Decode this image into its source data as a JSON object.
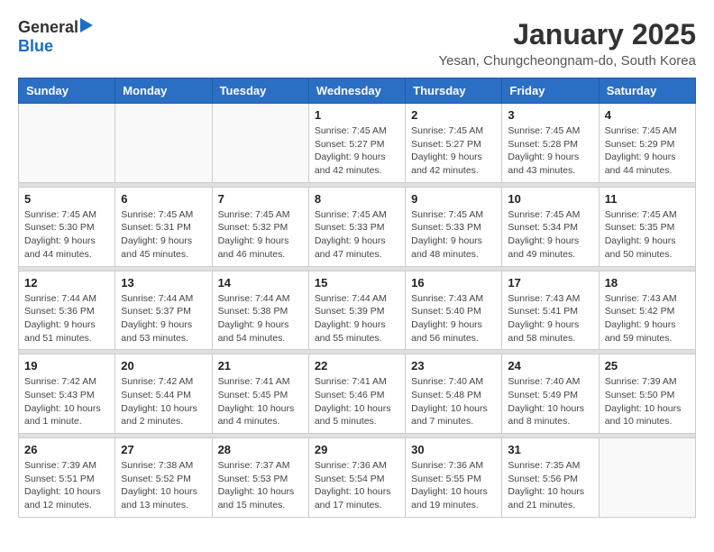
{
  "header": {
    "logo_general": "General",
    "logo_blue": "Blue",
    "month_title": "January 2025",
    "location": "Yesan, Chungcheongnam-do, South Korea"
  },
  "weekdays": [
    "Sunday",
    "Monday",
    "Tuesday",
    "Wednesday",
    "Thursday",
    "Friday",
    "Saturday"
  ],
  "weeks": [
    {
      "days": [
        {
          "num": "",
          "info": ""
        },
        {
          "num": "",
          "info": ""
        },
        {
          "num": "",
          "info": ""
        },
        {
          "num": "1",
          "info": "Sunrise: 7:45 AM\nSunset: 5:27 PM\nDaylight: 9 hours\nand 42 minutes."
        },
        {
          "num": "2",
          "info": "Sunrise: 7:45 AM\nSunset: 5:27 PM\nDaylight: 9 hours\nand 42 minutes."
        },
        {
          "num": "3",
          "info": "Sunrise: 7:45 AM\nSunset: 5:28 PM\nDaylight: 9 hours\nand 43 minutes."
        },
        {
          "num": "4",
          "info": "Sunrise: 7:45 AM\nSunset: 5:29 PM\nDaylight: 9 hours\nand 44 minutes."
        }
      ]
    },
    {
      "days": [
        {
          "num": "5",
          "info": "Sunrise: 7:45 AM\nSunset: 5:30 PM\nDaylight: 9 hours\nand 44 minutes."
        },
        {
          "num": "6",
          "info": "Sunrise: 7:45 AM\nSunset: 5:31 PM\nDaylight: 9 hours\nand 45 minutes."
        },
        {
          "num": "7",
          "info": "Sunrise: 7:45 AM\nSunset: 5:32 PM\nDaylight: 9 hours\nand 46 minutes."
        },
        {
          "num": "8",
          "info": "Sunrise: 7:45 AM\nSunset: 5:33 PM\nDaylight: 9 hours\nand 47 minutes."
        },
        {
          "num": "9",
          "info": "Sunrise: 7:45 AM\nSunset: 5:33 PM\nDaylight: 9 hours\nand 48 minutes."
        },
        {
          "num": "10",
          "info": "Sunrise: 7:45 AM\nSunset: 5:34 PM\nDaylight: 9 hours\nand 49 minutes."
        },
        {
          "num": "11",
          "info": "Sunrise: 7:45 AM\nSunset: 5:35 PM\nDaylight: 9 hours\nand 50 minutes."
        }
      ]
    },
    {
      "days": [
        {
          "num": "12",
          "info": "Sunrise: 7:44 AM\nSunset: 5:36 PM\nDaylight: 9 hours\nand 51 minutes."
        },
        {
          "num": "13",
          "info": "Sunrise: 7:44 AM\nSunset: 5:37 PM\nDaylight: 9 hours\nand 53 minutes."
        },
        {
          "num": "14",
          "info": "Sunrise: 7:44 AM\nSunset: 5:38 PM\nDaylight: 9 hours\nand 54 minutes."
        },
        {
          "num": "15",
          "info": "Sunrise: 7:44 AM\nSunset: 5:39 PM\nDaylight: 9 hours\nand 55 minutes."
        },
        {
          "num": "16",
          "info": "Sunrise: 7:43 AM\nSunset: 5:40 PM\nDaylight: 9 hours\nand 56 minutes."
        },
        {
          "num": "17",
          "info": "Sunrise: 7:43 AM\nSunset: 5:41 PM\nDaylight: 9 hours\nand 58 minutes."
        },
        {
          "num": "18",
          "info": "Sunrise: 7:43 AM\nSunset: 5:42 PM\nDaylight: 9 hours\nand 59 minutes."
        }
      ]
    },
    {
      "days": [
        {
          "num": "19",
          "info": "Sunrise: 7:42 AM\nSunset: 5:43 PM\nDaylight: 10 hours\nand 1 minute."
        },
        {
          "num": "20",
          "info": "Sunrise: 7:42 AM\nSunset: 5:44 PM\nDaylight: 10 hours\nand 2 minutes."
        },
        {
          "num": "21",
          "info": "Sunrise: 7:41 AM\nSunset: 5:45 PM\nDaylight: 10 hours\nand 4 minutes."
        },
        {
          "num": "22",
          "info": "Sunrise: 7:41 AM\nSunset: 5:46 PM\nDaylight: 10 hours\nand 5 minutes."
        },
        {
          "num": "23",
          "info": "Sunrise: 7:40 AM\nSunset: 5:48 PM\nDaylight: 10 hours\nand 7 minutes."
        },
        {
          "num": "24",
          "info": "Sunrise: 7:40 AM\nSunset: 5:49 PM\nDaylight: 10 hours\nand 8 minutes."
        },
        {
          "num": "25",
          "info": "Sunrise: 7:39 AM\nSunset: 5:50 PM\nDaylight: 10 hours\nand 10 minutes."
        }
      ]
    },
    {
      "days": [
        {
          "num": "26",
          "info": "Sunrise: 7:39 AM\nSunset: 5:51 PM\nDaylight: 10 hours\nand 12 minutes."
        },
        {
          "num": "27",
          "info": "Sunrise: 7:38 AM\nSunset: 5:52 PM\nDaylight: 10 hours\nand 13 minutes."
        },
        {
          "num": "28",
          "info": "Sunrise: 7:37 AM\nSunset: 5:53 PM\nDaylight: 10 hours\nand 15 minutes."
        },
        {
          "num": "29",
          "info": "Sunrise: 7:36 AM\nSunset: 5:54 PM\nDaylight: 10 hours\nand 17 minutes."
        },
        {
          "num": "30",
          "info": "Sunrise: 7:36 AM\nSunset: 5:55 PM\nDaylight: 10 hours\nand 19 minutes."
        },
        {
          "num": "31",
          "info": "Sunrise: 7:35 AM\nSunset: 5:56 PM\nDaylight: 10 hours\nand 21 minutes."
        },
        {
          "num": "",
          "info": ""
        }
      ]
    }
  ]
}
